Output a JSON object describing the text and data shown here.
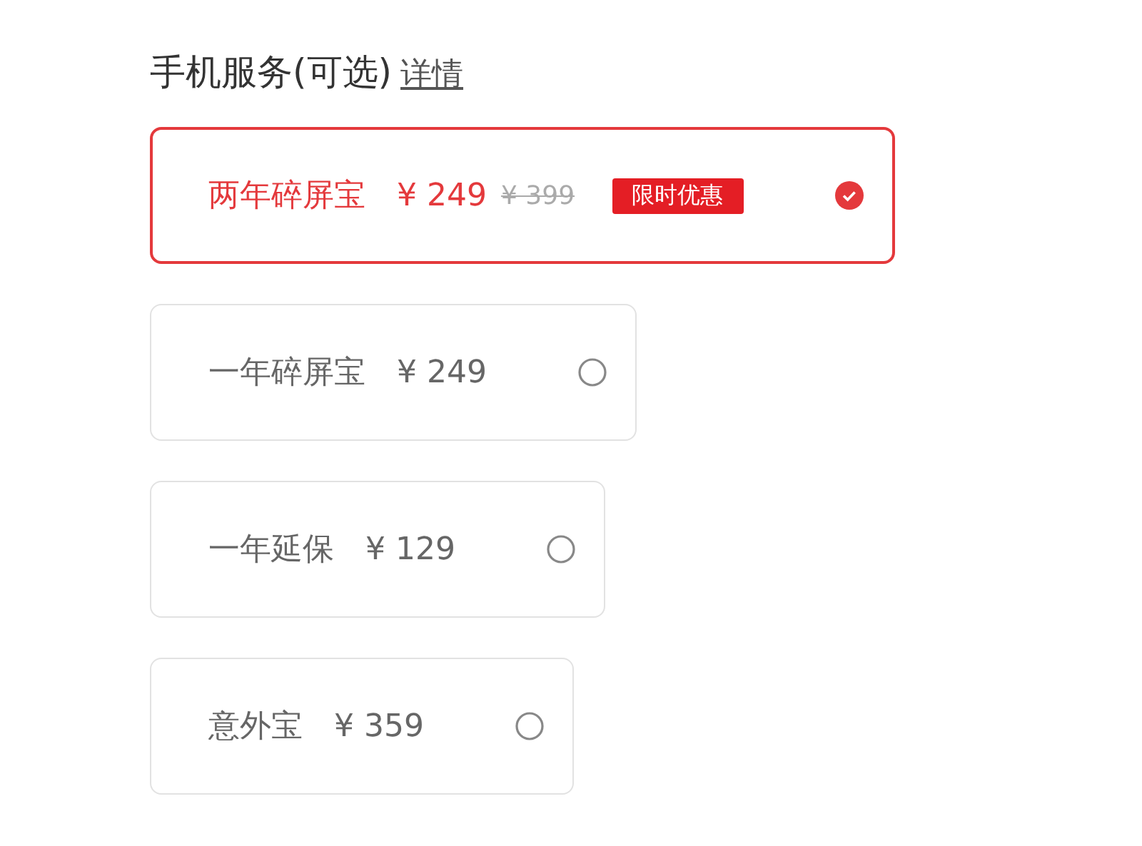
{
  "section": {
    "title": "手机服务(可选)",
    "details_link": "详情"
  },
  "options": [
    {
      "name": "两年碎屏宝",
      "price": "¥ 249",
      "original_price": "¥ 399",
      "badge": "限时优惠",
      "selected": true
    },
    {
      "name": "一年碎屏宝",
      "price": "¥ 249",
      "selected": false
    },
    {
      "name": "一年延保",
      "price": "¥ 129",
      "selected": false
    },
    {
      "name": "意外宝",
      "price": "¥ 359",
      "selected": false
    }
  ]
}
